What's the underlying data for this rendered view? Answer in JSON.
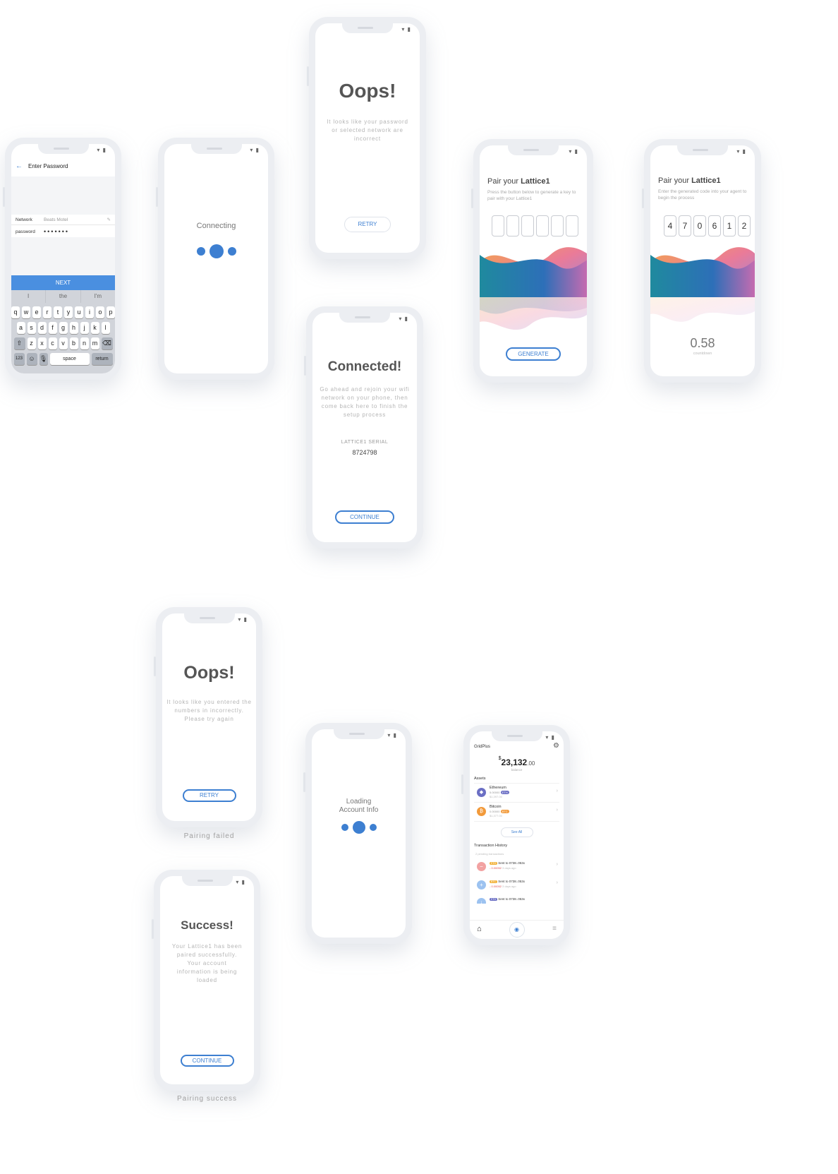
{
  "colors": {
    "accent": "#3d7fd1",
    "orange": "#f29a3a",
    "gray_text": "#b5b5b5"
  },
  "status_bar": "▾ ▮",
  "enter_password": {
    "back_icon": "back-arrow-icon",
    "title": "Enter Password",
    "network_label": "Network",
    "network_value": "Beats Motel",
    "password_label": "password",
    "password_value": "•••••••",
    "next_label": "NEXT",
    "suggestions": [
      "I",
      "the",
      "I'm"
    ],
    "row1": [
      "q",
      "w",
      "e",
      "r",
      "t",
      "y",
      "u",
      "i",
      "o",
      "p"
    ],
    "row2": [
      "a",
      "s",
      "d",
      "f",
      "g",
      "h",
      "j",
      "k",
      "l"
    ],
    "row3": [
      "z",
      "x",
      "c",
      "v",
      "b",
      "n",
      "m"
    ],
    "key_123": "123",
    "key_space": "space",
    "key_return": "return"
  },
  "connecting": {
    "label": "Connecting"
  },
  "oops_password": {
    "title": "Oops!",
    "message": "It looks like your password or selected network are incorrect",
    "retry_label": "RETRY"
  },
  "connected": {
    "title": "Connected!",
    "message": "Go ahead and rejoin your wifi network on your phone, then come back here to finish the setup process",
    "serial_label": "LATTICE1 SERIAL",
    "serial_value": "8724798",
    "continue_label": "CONTINUE"
  },
  "pair_generate": {
    "title_prefix": "Pair your ",
    "title_bold": "Lattice1",
    "subtitle": "Press the button below to generate a key to pair with your Lattice1",
    "generate_label": "GENERATE"
  },
  "pair_code": {
    "title_prefix": "Pair your ",
    "title_bold": "Lattice1",
    "subtitle": "Enter the generated code into your agent to begin the process",
    "code": [
      "4",
      "7",
      "0",
      "6",
      "1",
      "2"
    ],
    "countdown_value": "0.58",
    "countdown_label": "countdown"
  },
  "oops_pairing": {
    "title": "Oops!",
    "message": "It looks like you entered the numbers in incorrectly. Please try again",
    "retry_label": "RETRY",
    "caption": "Pairing failed"
  },
  "loading": {
    "line1": "Loading",
    "line2": "Account Info"
  },
  "success": {
    "title": "Success!",
    "message": "Your Lattice1 has been paired successfully. Your account information is being loaded",
    "continue_label": "CONTINUE",
    "caption": "Pairing success"
  },
  "dashboard": {
    "brand": "GridPlus",
    "currency": "$",
    "balance_main": "23,132",
    "balance_cents": ".00",
    "balance_label": "balance",
    "assets_title": "Assets",
    "assets": [
      {
        "name": "Ethereum",
        "amount": "5.00000",
        "fiat": "$1,397.00",
        "badge": "ETH",
        "color": "#6b6fc4",
        "glyph": "◆"
      },
      {
        "name": "Bitcoin",
        "amount": "0.00000",
        "fiat": "$1,377.00",
        "badge": "BTC",
        "color": "#f29a3a",
        "glyph": "₿"
      }
    ],
    "see_all_label": "See All",
    "tx_title": "Transaction History",
    "tx_pending": "2 pending transactions",
    "transactions": [
      {
        "badge": "ETH",
        "text": "Sent to 0738..053x",
        "amount": "- 0.00052",
        "time": "3 days ago",
        "icon": "minus-icon",
        "icon_color": "#f2a2a2"
      },
      {
        "badge": "BTC",
        "text": "Sent to 0738..053x",
        "amount": "- 0.00052",
        "time": "3 days ago",
        "icon": "plus-icon",
        "icon_color": "#9cc2f0"
      },
      {
        "badge": "ETH",
        "text": "Sent to 0738..053x",
        "amount": "",
        "time": "",
        "icon": "down-icon",
        "icon_color": "#9cc2f0"
      }
    ]
  }
}
